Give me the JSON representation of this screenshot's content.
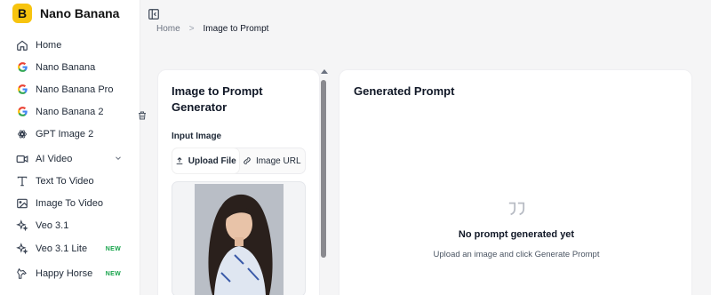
{
  "brand": {
    "logo_letter": "B",
    "name": "Nano Banana"
  },
  "sidebar": {
    "items": [
      {
        "label": "Home",
        "icon": "home-icon"
      },
      {
        "label": "Nano Banana",
        "icon": "google-icon"
      },
      {
        "label": "Nano Banana Pro",
        "icon": "google-icon"
      },
      {
        "label": "Nano Banana 2",
        "icon": "google-icon"
      },
      {
        "label": "GPT Image 2",
        "icon": "openai-icon"
      },
      {
        "label": "AI Video",
        "icon": "video-icon"
      },
      {
        "label": "Text To Video",
        "icon": "text-icon"
      },
      {
        "label": "Image To Video",
        "icon": "image-icon"
      },
      {
        "label": "Veo 3.1",
        "icon": "sparkle-icon"
      },
      {
        "label": "Veo 3.1 Lite",
        "icon": "sparkle-icon",
        "badge": "NEW"
      },
      {
        "label": "Happy Horse",
        "icon": "horse-icon",
        "badge": "NEW"
      }
    ]
  },
  "breadcrumb": {
    "home": "Home",
    "separator": ">",
    "current": "Image to Prompt"
  },
  "left_card": {
    "title": "Image to Prompt Generator",
    "input_label": "Input Image",
    "tabs": [
      {
        "label": "Upload File",
        "icon": "upload-icon",
        "active": true
      },
      {
        "label": "Image URL",
        "icon": "link-icon",
        "active": false
      }
    ]
  },
  "right_card": {
    "title": "Generated Prompt",
    "empty_title": "No prompt generated yet",
    "empty_subtitle": "Upload an image and click Generate Prompt"
  },
  "colors": {
    "brand": "#f7c40f",
    "badge_new": "#16a34a",
    "background": "#f5f5f6"
  }
}
